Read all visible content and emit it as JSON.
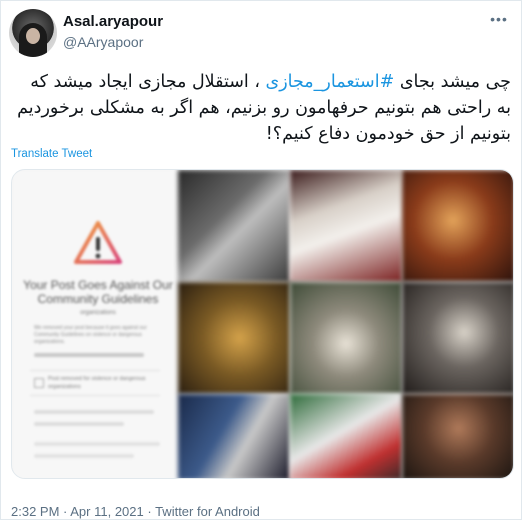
{
  "user": {
    "display_name": "Asal.aryapour",
    "handle": "@AAryapoor",
    "avatar_icon": "avatar-photo"
  },
  "tweet": {
    "text_before": "چی میشد بجای ",
    "hashtag": "#استعمار_مجازی",
    "text_after": " ، استقلال مجازی ایجاد میشد که به راحتی هم بتونیم حرفهامون رو بزنیم، هم اگر به مشکلی برخوردیم بتونیم از حق خودمون دفاع کنیم؟!",
    "translate_label": "Translate Tweet",
    "more_icon": "more-options-icon"
  },
  "media": {
    "notice_title": "Your Post Goes Against Our Community Guidelines",
    "notice_subtitle": "organizations",
    "notice_body": "We removed your post because it goes against our Community Guidelines on violence or dangerous organizations.",
    "removed_reason": "Post removed for violence or dangerous organizations",
    "warning_icon": "warning-triangle-icon",
    "colors": {
      "warning_orange": "#e8893a",
      "warning_pink": "#d9457a",
      "panel_bg": "#f7f7f7"
    }
  },
  "meta": {
    "time": "2:32 PM",
    "separator": " · ",
    "date": "Apr 11, 2021",
    "source": "Twitter for Android"
  }
}
